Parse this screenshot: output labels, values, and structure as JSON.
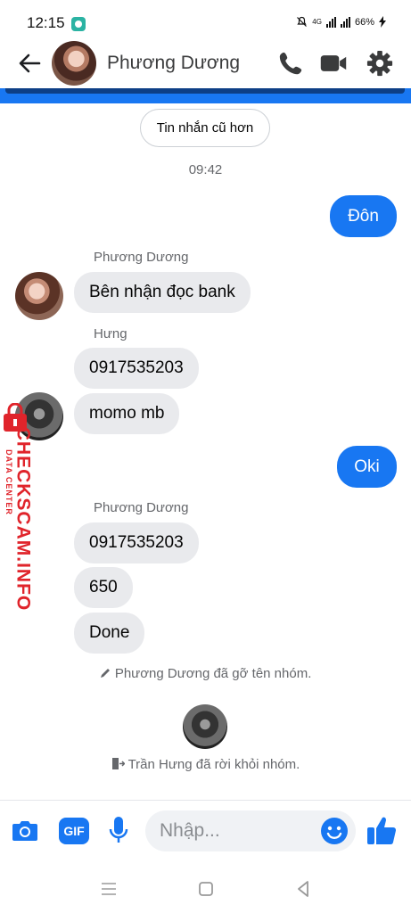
{
  "status_bar": {
    "time": "12:15",
    "network": "4G",
    "battery": "66%"
  },
  "header": {
    "contact_name": "Phương Dương",
    "icons": [
      "back-arrow-icon",
      "phone-icon",
      "video-camera-icon",
      "gear-icon"
    ]
  },
  "conversation": {
    "older_messages_label": "Tin nhắn cũ hơn",
    "timestamp": "09:42",
    "messages": [
      {
        "direction": "out",
        "text": "Đôn"
      },
      {
        "direction": "in",
        "sender": "Phương Dương",
        "text": "Bên nhận đọc bank"
      },
      {
        "direction": "in",
        "sender": "Hưng",
        "text": "0917535203"
      },
      {
        "direction": "in",
        "text": "momo mb"
      },
      {
        "direction": "out",
        "text": "Oki"
      },
      {
        "direction": "in",
        "sender": "Phương Dương",
        "text": "0917535203"
      },
      {
        "direction": "in",
        "text": "650"
      },
      {
        "direction": "in",
        "text": "Done"
      }
    ],
    "system_messages": [
      "Phương Dương đã gỡ tên nhóm.",
      "Trần Hưng đã rời khỏi nhóm."
    ]
  },
  "watermark": {
    "main": "CHECKSCAM.INFO",
    "sub": "DATA CENTER"
  },
  "composer": {
    "placeholder": "Nhập...",
    "gif_label": "GIF",
    "icons": [
      "camera-icon",
      "gif-icon",
      "microphone-icon",
      "emoji-icon",
      "thumbs-up-icon"
    ]
  },
  "colors": {
    "accent": "#1877f2",
    "bubble_in": "#e9eaed",
    "watermark": "#e0242b"
  }
}
